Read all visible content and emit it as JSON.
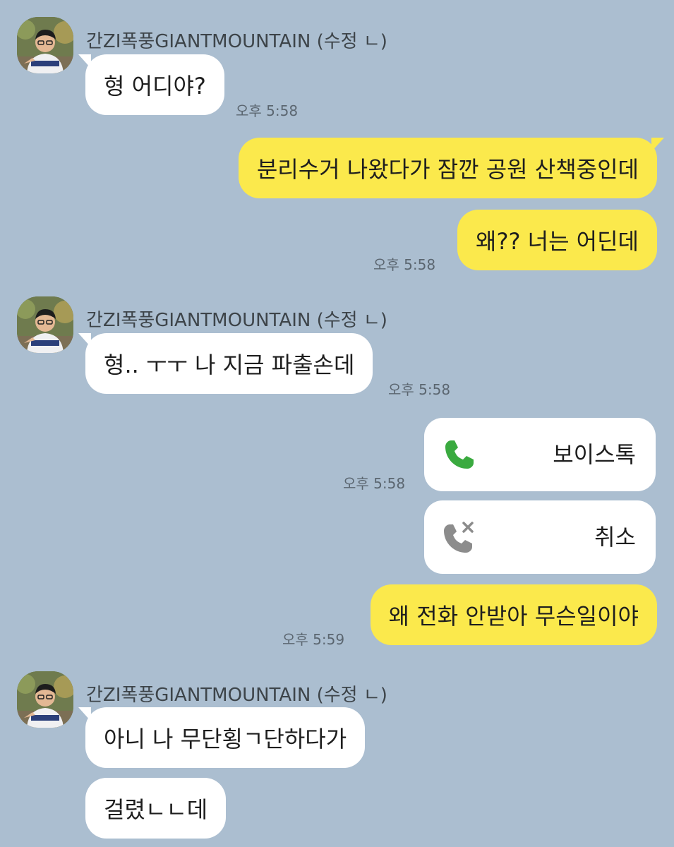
{
  "chat": {
    "sender_name": "간ZI폭풍GIANTMOUNTAIN (수정 ㄴ)",
    "messages": [
      {
        "text": "형 어디야?"
      },
      {
        "text": "분리수거 나왔다가 잠깐 공원 산책중인데"
      },
      {
        "text": "왜?? 너는 어딘데"
      },
      {
        "text": "형.. ㅜㅜ 나 지금 파출손데"
      },
      {
        "text": "왜 전화 안받아 무슨일이야"
      },
      {
        "text": "아니 나 무단횡ㄱ단하다가"
      },
      {
        "text": "걸렸ㄴㄴ데"
      }
    ],
    "calls": [
      {
        "label": "보이스톡",
        "icon": "phone-icon",
        "color": "#3aaa3f"
      },
      {
        "label": "취소",
        "icon": "phone-cancelled-icon",
        "color": "#8c8c8c"
      }
    ],
    "timestamps": [
      "오후 5:58",
      "오후 5:58",
      "오후 5:58",
      "오후 5:58",
      "오후 5:59"
    ]
  },
  "colors": {
    "background": "#abbed0",
    "outgoing_bubble": "#fbe94c",
    "incoming_bubble": "#ffffff"
  }
}
